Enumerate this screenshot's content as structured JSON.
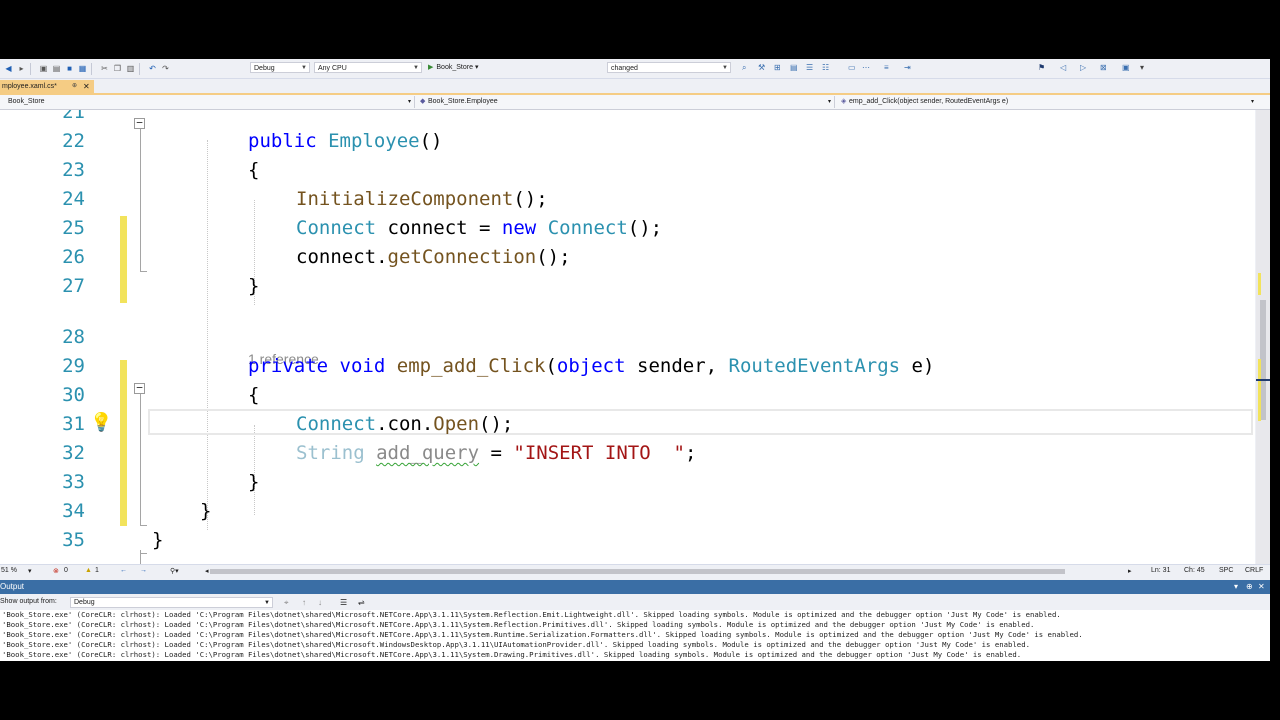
{
  "toolbar": {
    "configuration": "Debug",
    "platform": "Any CPU",
    "startup_project": "Book_Store",
    "find_box": "changed"
  },
  "tab": {
    "label": "mployee.xaml.cs*",
    "pin_glyph": "⊕",
    "close_glyph": "✕"
  },
  "navbar": {
    "project": "Book_Store",
    "class": "Book_Store.Employee",
    "member": "emp_add_Click(object sender, RoutedEventArgs e)"
  },
  "editor": {
    "line_numbers": [
      "21",
      "22",
      "23",
      "24",
      "25",
      "26",
      "27",
      "28",
      "29",
      "30",
      "31",
      "32",
      "33",
      "34",
      "35"
    ],
    "codelens": "1 reference",
    "lines": {
      "l21": {
        "kw": "public",
        "ty": "Employee",
        "rest": "()"
      },
      "l22": "{",
      "l23": {
        "method": "InitializeComponent",
        "rest": "();"
      },
      "l24": {
        "ty1": "Connect",
        "mid": " connect = ",
        "kw": "new",
        "sp": " ",
        "ty2": "Connect",
        "rest": "();"
      },
      "l25": {
        "pre": "connect.",
        "method": "getConnection",
        "rest": "();"
      },
      "l26": "}",
      "l28": {
        "kw1": "private",
        "sp1": " ",
        "kw2": "void",
        "sp2": " ",
        "method": "emp_add_Click",
        "p1": "(",
        "kw3": "object",
        "p2": " sender, ",
        "ty": "RoutedEventArgs",
        "p3": " e)"
      },
      "l29": "{",
      "l30": {
        "ty": "Connect",
        "mid": ".con.",
        "method": "Open",
        "rest": "();"
      },
      "l31": {
        "ty": "String",
        "sp": " ",
        "var": "add_query",
        "eq": " = ",
        "str": "\"INSERT INTO  \"",
        "end": ";"
      },
      "l32": "}",
      "l33": "}",
      "l34": "}"
    }
  },
  "statusbar": {
    "zoom": "51 %",
    "errors": "0",
    "warnings": "1",
    "line": "Ln: 31",
    "col": "Ch: 45",
    "spc": "SPC",
    "crlf": "CRLF"
  },
  "output": {
    "title": "Output",
    "show_from_label": "Show output from:",
    "show_from_value": "Debug",
    "lines": [
      "'Book_Store.exe' (CoreCLR: clrhost): Loaded 'C:\\Program Files\\dotnet\\shared\\Microsoft.NETCore.App\\3.1.11\\System.Reflection.Emit.Lightweight.dll'. Skipped loading symbols. Module is optimized and the debugger option 'Just My Code' is enabled.",
      "'Book_Store.exe' (CoreCLR: clrhost): Loaded 'C:\\Program Files\\dotnet\\shared\\Microsoft.NETCore.App\\3.1.11\\System.Reflection.Primitives.dll'. Skipped loading symbols. Module is optimized and the debugger option 'Just My Code' is enabled.",
      "'Book_Store.exe' (CoreCLR: clrhost): Loaded 'C:\\Program Files\\dotnet\\shared\\Microsoft.NETCore.App\\3.1.11\\System.Runtime.Serialization.Formatters.dll'. Skipped loading symbols. Module is optimized and the debugger option 'Just My Code' is enabled.",
      "'Book_Store.exe' (CoreCLR: clrhost): Loaded 'C:\\Program Files\\dotnet\\shared\\Microsoft.WindowsDesktop.App\\3.1.11\\UIAutomationProvider.dll'. Skipped loading symbols. Module is optimized and the debugger option 'Just My Code' is enabled.",
      "'Book_Store.exe' (CoreCLR: clrhost): Loaded 'C:\\Program Files\\dotnet\\shared\\Microsoft.NETCore.App\\3.1.11\\System.Drawing.Primitives.dll'. Skipped loading symbols. Module is optimized and the debugger option 'Just My Code' is enabled."
    ]
  },
  "colors": {
    "keyword": "#0000ff",
    "type": "#2b91af",
    "string": "#a31515",
    "method": "#74531f",
    "tab_active": "#f5cc84",
    "change_bar": "#f2e35c",
    "output_header": "#3a6ea5"
  }
}
